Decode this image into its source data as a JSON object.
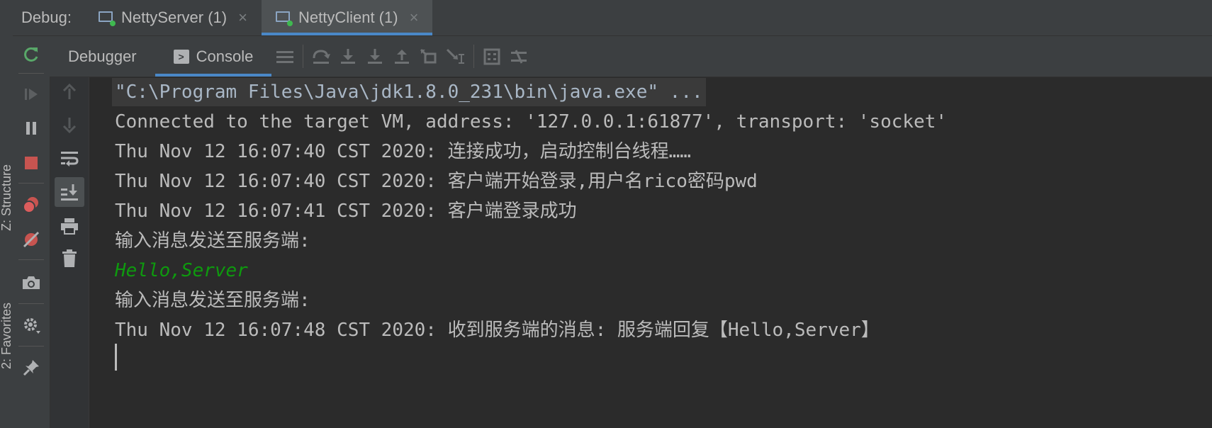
{
  "left_strip": {
    "labels": [
      "Z: Structure",
      "2: Favorites"
    ]
  },
  "debug_bar": {
    "label": "Debug:",
    "tabs": [
      {
        "label": "NettyServer (1)",
        "active": false
      },
      {
        "label": "NettyClient (1)",
        "active": true
      }
    ]
  },
  "toolbar": {
    "debugger_tab": "Debugger",
    "console_tab": "Console",
    "icons": [
      "list-icon",
      "step-over-icon",
      "step-into-icon",
      "force-step-into-icon",
      "step-out-icon",
      "drop-frame-icon",
      "run-to-cursor-icon",
      "evaluate-icon",
      "trace-icon"
    ]
  },
  "outer_toolbar_icons": [
    "rerun-icon",
    "resume-icon",
    "pause-icon",
    "stop-icon",
    "view-breakpoints-icon",
    "mute-breakpoints-icon",
    "camera-icon",
    "settings-icon",
    "pin-icon"
  ],
  "inner_toolbar_icons": [
    "up-arrow-icon",
    "down-arrow-icon",
    "soft-wrap-icon",
    "scroll-to-end-icon",
    "print-icon",
    "trash-icon"
  ],
  "console": {
    "lines": [
      {
        "text": "\"C:\\Program Files\\Java\\jdk1.8.0_231\\bin\\java.exe\" ...",
        "kind": "cmd"
      },
      {
        "text": "Connected to the target VM, address: '127.0.0.1:61877', transport: 'socket'",
        "kind": "out"
      },
      {
        "text": "Thu Nov 12 16:07:40 CST 2020: 连接成功，启动控制台线程……",
        "kind": "out"
      },
      {
        "text": "Thu Nov 12 16:07:40 CST 2020: 客户端开始登录,用户名rico密码pwd",
        "kind": "out"
      },
      {
        "text": "Thu Nov 12 16:07:41 CST 2020: 客户端登录成功",
        "kind": "out"
      },
      {
        "text": "输入消息发送至服务端:",
        "kind": "out"
      },
      {
        "text": "Hello,Server",
        "kind": "input"
      },
      {
        "text": "输入消息发送至服务端:",
        "kind": "out"
      },
      {
        "text": "Thu Nov 12 16:07:48 CST 2020: 收到服务端的消息: 服务端回复【Hello,Server】",
        "kind": "out"
      }
    ]
  },
  "colors": {
    "active_tab_underline": "#4a88c7",
    "user_input": "#0e9a0e",
    "stop_red": "#c75450",
    "running_green": "#3fb950"
  }
}
